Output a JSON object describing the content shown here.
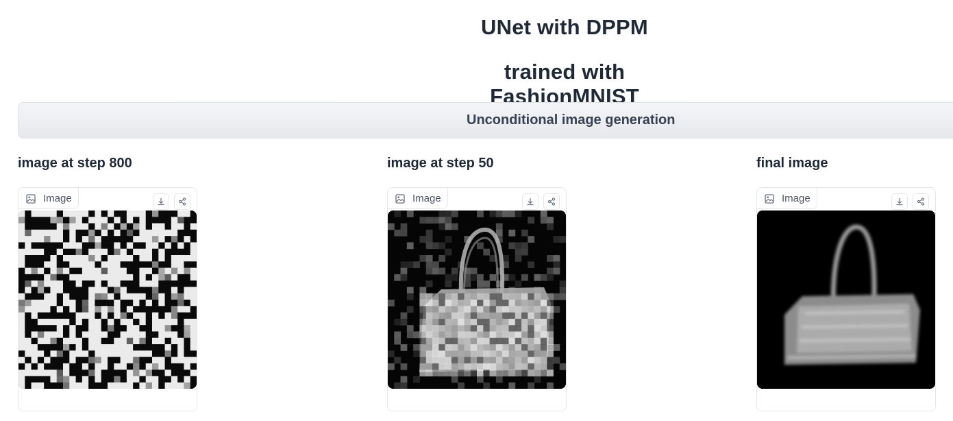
{
  "header": {
    "title_line1": "UNet with DPPM",
    "title_line2": "trained with FashionMNIST"
  },
  "generate_button": {
    "label": "Unconditional image generation"
  },
  "outputs": [
    {
      "label": "image at step 800",
      "tag": "Image"
    },
    {
      "label": "image at step 50",
      "tag": "Image"
    },
    {
      "label": "final image",
      "tag": "Image"
    }
  ],
  "icons": {
    "tag_icon": "image-icon",
    "download": "download-icon",
    "share": "share-icon"
  }
}
